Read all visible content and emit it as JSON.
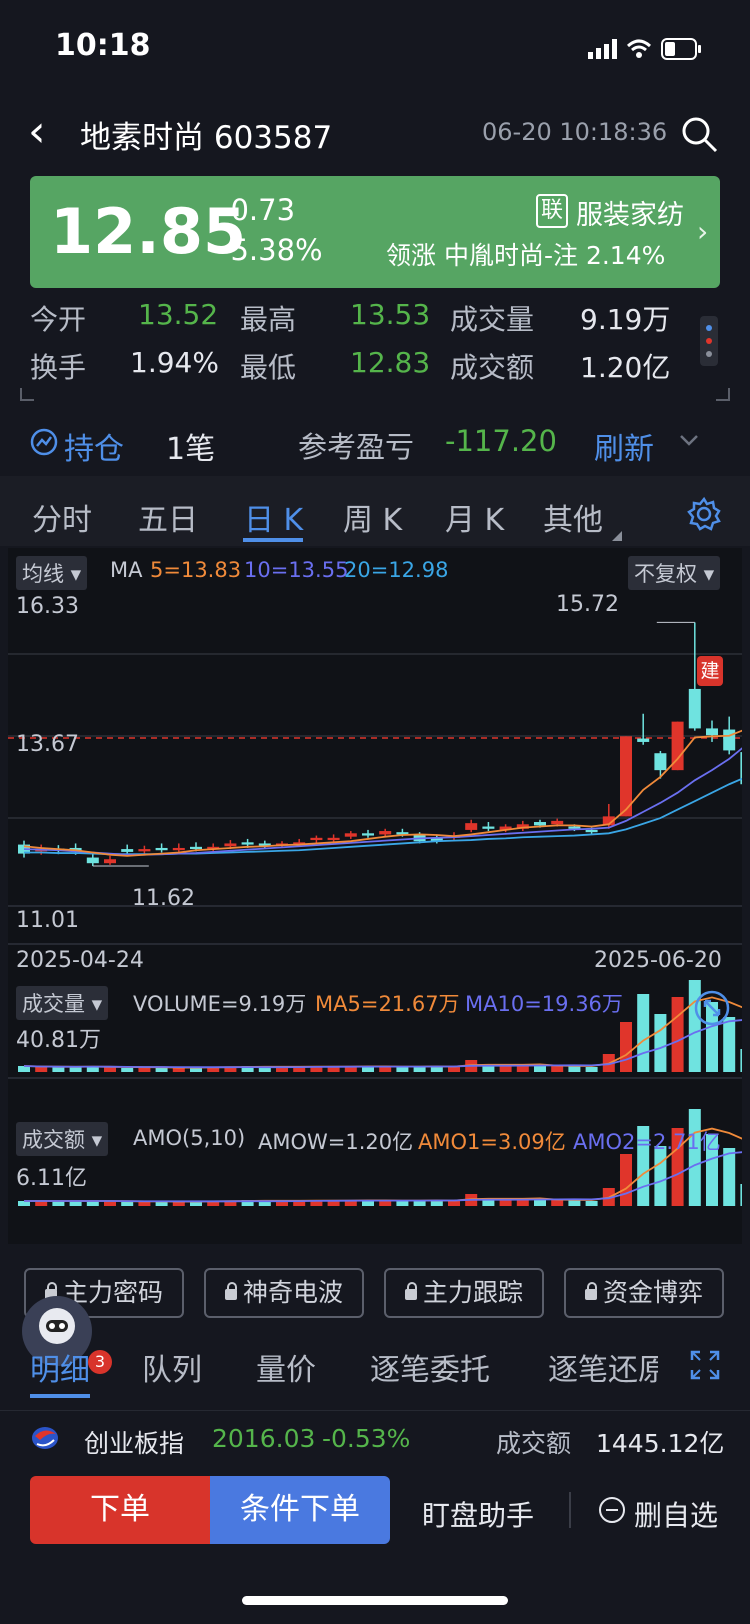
{
  "status_bar": {
    "time": "10:18"
  },
  "header": {
    "title": "地素时尚 603587",
    "datetime": "06-20 10:18:36"
  },
  "quote": {
    "price": "12.85",
    "change": "-0.73",
    "change_pct": "-5.38%",
    "lian_badge": "联",
    "sector": "服装家纺",
    "lead_label": "领涨",
    "lead_stock": "中胤时尚-注",
    "lead_pct": "2.14%"
  },
  "stats": [
    {
      "label": "今开",
      "value": "13.52"
    },
    {
      "label": "最高",
      "value": "13.53"
    },
    {
      "label": "成交量",
      "value": "9.19万"
    },
    {
      "label": "换手",
      "value": "1.94%"
    },
    {
      "label": "最低",
      "value": "12.83"
    },
    {
      "label": "成交额",
      "value": "1.20亿"
    }
  ],
  "holding": {
    "label": "持仓",
    "count": "1笔",
    "ref_label": "参考盈亏",
    "ref_value": "-117.20",
    "refresh": "刷新"
  },
  "chart_tabs": [
    "分时",
    "五日",
    "日 K",
    "周 K",
    "月 K",
    "其他"
  ],
  "kline": {
    "ma_dropdown": "均线",
    "ma_label": "MA",
    "ma5": "5=13.83",
    "ma10": "10=13.55",
    "ma20": "20=12.98",
    "adjust": "不复权",
    "y_top": "16.33",
    "y_ref": "13.67",
    "y_bottom": "11.01",
    "max_label": "15.72",
    "min_label": "11.62",
    "date_start": "2025-04-24",
    "date_end": "2025-06-20",
    "build_marker": "建"
  },
  "volume": {
    "dropdown": "成交量",
    "label": "VOLUME=9.19万",
    "ma5": "MA5=21.67万",
    "ma10": "MA10=19.36万",
    "y_top": "40.81万"
  },
  "amount": {
    "dropdown": "成交额",
    "label": "AMO(5,10)",
    "amow": "AMOW=1.20亿",
    "amo1": "AMO1=3.09亿",
    "amo2": "AMO2=2.71亿",
    "y_top": "6.11亿"
  },
  "lock_buttons": [
    "主力密码",
    "神奇电波",
    "主力跟踪",
    "资金博弈"
  ],
  "sub_tabs": {
    "items": [
      "明细",
      "队列",
      "量价",
      "逐笔委托",
      "逐笔还原"
    ],
    "badge": "3"
  },
  "index": {
    "name": "创业板指",
    "value": "2016.03",
    "pct": "-0.53%",
    "amount_label": "成交额",
    "amount": "1445.12亿"
  },
  "bottom": {
    "order": "下单",
    "cond_order": "条件下单",
    "helper": "盯盘助手",
    "remove": "删自选"
  },
  "colors": {
    "up": "#e0352b",
    "down": "#6fe3e0",
    "green": "#55b54b",
    "accent": "#4f8fe8",
    "ma5": "#f08a3a",
    "ma10": "#6a6ff0",
    "ma20": "#3aa6e6"
  },
  "chart_data": {
    "type": "candlestick",
    "price_axis": {
      "top": 16.33,
      "bottom": 11.01,
      "ref": 13.67
    },
    "candles": [
      {
        "o": 11.78,
        "c": 11.62,
        "h": 11.85,
        "l": 11.55
      },
      {
        "o": 11.66,
        "c": 11.7,
        "h": 11.78,
        "l": 11.6
      },
      {
        "o": 11.71,
        "c": 11.68,
        "h": 11.77,
        "l": 11.61
      },
      {
        "o": 11.72,
        "c": 11.66,
        "h": 11.8,
        "l": 11.6
      },
      {
        "o": 11.55,
        "c": 11.45,
        "h": 11.62,
        "l": 11.4
      },
      {
        "o": 11.45,
        "c": 11.52,
        "h": 11.58,
        "l": 11.42
      },
      {
        "o": 11.7,
        "c": 11.65,
        "h": 11.78,
        "l": 11.6
      },
      {
        "o": 11.66,
        "c": 11.7,
        "h": 11.76,
        "l": 11.62
      },
      {
        "o": 11.72,
        "c": 11.68,
        "h": 11.8,
        "l": 11.64
      },
      {
        "o": 11.68,
        "c": 11.72,
        "h": 11.8,
        "l": 11.65
      },
      {
        "o": 11.74,
        "c": 11.7,
        "h": 11.82,
        "l": 11.66
      },
      {
        "o": 11.7,
        "c": 11.74,
        "h": 11.8,
        "l": 11.66
      },
      {
        "o": 11.75,
        "c": 11.8,
        "h": 11.86,
        "l": 11.7
      },
      {
        "o": 11.82,
        "c": 11.78,
        "h": 11.88,
        "l": 11.72
      },
      {
        "o": 11.8,
        "c": 11.76,
        "h": 11.85,
        "l": 11.72
      },
      {
        "o": 11.76,
        "c": 11.8,
        "h": 11.84,
        "l": 11.72
      },
      {
        "o": 11.78,
        "c": 11.82,
        "h": 11.88,
        "l": 11.74
      },
      {
        "o": 11.86,
        "c": 11.9,
        "h": 11.94,
        "l": 11.8
      },
      {
        "o": 11.86,
        "c": 11.9,
        "h": 11.96,
        "l": 11.8
      },
      {
        "o": 11.92,
        "c": 11.98,
        "h": 12.02,
        "l": 11.88
      },
      {
        "o": 11.98,
        "c": 11.94,
        "h": 12.04,
        "l": 11.9
      },
      {
        "o": 11.96,
        "c": 12.02,
        "h": 12.06,
        "l": 11.92
      },
      {
        "o": 12.0,
        "c": 11.96,
        "h": 12.06,
        "l": 11.92
      },
      {
        "o": 11.96,
        "c": 11.84,
        "h": 12.0,
        "l": 11.8
      },
      {
        "o": 11.9,
        "c": 11.84,
        "h": 11.96,
        "l": 11.8
      },
      {
        "o": 11.9,
        "c": 11.94,
        "h": 12.0,
        "l": 11.86
      },
      {
        "o": 12.04,
        "c": 12.16,
        "h": 12.22,
        "l": 12.0
      },
      {
        "o": 12.1,
        "c": 12.06,
        "h": 12.18,
        "l": 12.02
      },
      {
        "o": 12.04,
        "c": 12.1,
        "h": 12.14,
        "l": 12.0
      },
      {
        "o": 12.06,
        "c": 12.14,
        "h": 12.2,
        "l": 12.02
      },
      {
        "o": 12.18,
        "c": 12.12,
        "h": 12.22,
        "l": 12.08
      },
      {
        "o": 12.14,
        "c": 12.2,
        "h": 12.24,
        "l": 12.1
      },
      {
        "o": 12.1,
        "c": 12.06,
        "h": 12.14,
        "l": 12.02
      },
      {
        "o": 12.04,
        "c": 12.0,
        "h": 12.08,
        "l": 11.96
      },
      {
        "o": 12.12,
        "c": 12.28,
        "h": 12.5,
        "l": 12.06
      },
      {
        "o": 12.28,
        "c": 13.7,
        "h": 13.7,
        "l": 12.28
      },
      {
        "o": 13.66,
        "c": 13.6,
        "h": 14.1,
        "l": 13.55
      },
      {
        "o": 13.4,
        "c": 13.1,
        "h": 13.44,
        "l": 12.95
      },
      {
        "o": 13.1,
        "c": 13.96,
        "h": 13.96,
        "l": 13.1
      },
      {
        "o": 14.54,
        "c": 13.84,
        "h": 15.72,
        "l": 13.8
      },
      {
        "o": 13.84,
        "c": 13.72,
        "h": 13.98,
        "l": 13.6
      },
      {
        "o": 13.82,
        "c": 13.45,
        "h": 14.05,
        "l": 13.38
      },
      {
        "o": 13.42,
        "c": 12.85,
        "h": 13.53,
        "l": 12.83
      }
    ],
    "ma5": [
      11.75,
      11.72,
      11.7,
      11.68,
      11.64,
      11.6,
      11.58,
      11.6,
      11.62,
      11.64,
      11.68,
      11.7,
      11.72,
      11.74,
      11.75,
      11.77,
      11.78,
      11.8,
      11.82,
      11.84,
      11.88,
      11.92,
      11.95,
      11.96,
      11.95,
      11.93,
      11.96,
      12.0,
      12.04,
      12.08,
      12.1,
      12.12,
      12.12,
      12.1,
      12.14,
      12.4,
      12.75,
      12.98,
      13.3,
      13.68,
      13.7,
      13.71,
      13.83
    ],
    "ma10": [
      11.7,
      11.69,
      11.68,
      11.66,
      11.64,
      11.62,
      11.6,
      11.6,
      11.61,
      11.62,
      11.63,
      11.65,
      11.67,
      11.69,
      11.71,
      11.73,
      11.75,
      11.77,
      11.79,
      11.81,
      11.83,
      11.85,
      11.87,
      11.89,
      11.9,
      11.91,
      11.93,
      11.95,
      11.97,
      11.99,
      12.01,
      12.03,
      12.05,
      12.06,
      12.08,
      12.2,
      12.36,
      12.52,
      12.7,
      12.92,
      13.1,
      13.3,
      13.55
    ],
    "ma20": [
      11.64,
      11.64,
      11.63,
      11.63,
      11.62,
      11.61,
      11.61,
      11.61,
      11.61,
      11.62,
      11.62,
      11.63,
      11.64,
      11.65,
      11.66,
      11.67,
      11.68,
      11.7,
      11.72,
      11.74,
      11.76,
      11.78,
      11.8,
      11.82,
      11.84,
      11.85,
      11.86,
      11.88,
      11.89,
      11.91,
      11.92,
      11.93,
      11.94,
      11.96,
      11.98,
      12.05,
      12.15,
      12.25,
      12.4,
      12.55,
      12.7,
      12.85,
      12.98
    ],
    "volume_rel": [
      0.06,
      0.05,
      0.05,
      0.05,
      0.06,
      0.05,
      0.04,
      0.04,
      0.05,
      0.04,
      0.05,
      0.05,
      0.05,
      0.06,
      0.05,
      0.05,
      0.05,
      0.06,
      0.06,
      0.05,
      0.06,
      0.05,
      0.05,
      0.06,
      0.06,
      0.05,
      0.12,
      0.07,
      0.06,
      0.06,
      0.07,
      0.06,
      0.06,
      0.05,
      0.18,
      0.5,
      0.78,
      0.58,
      0.75,
      0.92,
      0.7,
      0.55,
      0.23
    ],
    "amount_rel": [
      0.05,
      0.05,
      0.05,
      0.05,
      0.05,
      0.05,
      0.04,
      0.04,
      0.05,
      0.04,
      0.05,
      0.05,
      0.05,
      0.06,
      0.05,
      0.05,
      0.05,
      0.06,
      0.06,
      0.05,
      0.06,
      0.05,
      0.05,
      0.06,
      0.06,
      0.05,
      0.12,
      0.07,
      0.06,
      0.06,
      0.07,
      0.06,
      0.06,
      0.05,
      0.18,
      0.52,
      0.8,
      0.6,
      0.78,
      0.97,
      0.72,
      0.58,
      0.22
    ]
  }
}
